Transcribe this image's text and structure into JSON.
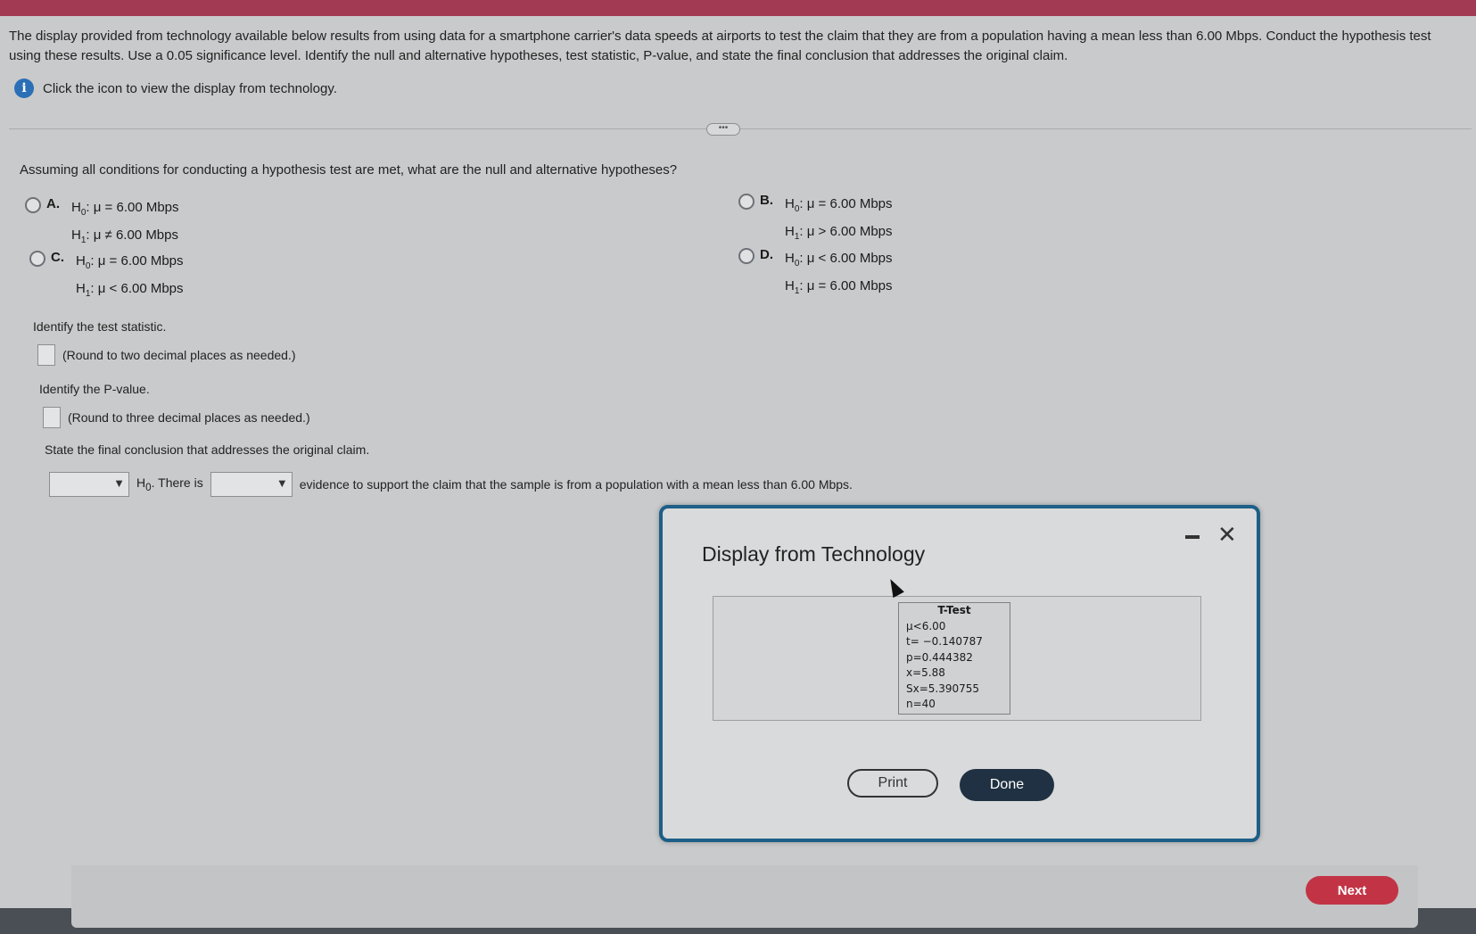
{
  "intro": {
    "text": "The display provided from technology available below results from using data for a smartphone carrier's data speeds at airports to test the claim that they are from a population having a mean less than 6.00 Mbps. Conduct the hypothesis test using these results. Use a 0.05 significance level. Identify the null and alternative hypotheses, test statistic, P-value, and state the final conclusion that addresses the original claim.",
    "info_link": "Click the icon to view the display from technology."
  },
  "collapse_handle": "•••",
  "question": "Assuming all conditions for conducting a hypothesis test are met, what are the null and alternative hypotheses?",
  "options": [
    {
      "letter": "A.",
      "h0_rel": ": μ = 6.00 Mbps",
      "h1_rel": ": μ ≠ 6.00 Mbps"
    },
    {
      "letter": "B.",
      "h0_rel": ": μ = 6.00 Mbps",
      "h1_rel": ": μ > 6.00 Mbps"
    },
    {
      "letter": "C.",
      "h0_rel": ": μ = 6.00 Mbps",
      "h1_rel": ": μ < 6.00 Mbps"
    },
    {
      "letter": "D.",
      "h0_rel": ": μ < 6.00 Mbps",
      "h1_rel": ": μ = 6.00 Mbps"
    }
  ],
  "hyp_symbols": {
    "h": "H",
    "sub0": "0",
    "sub1": "1"
  },
  "test_stat": {
    "label": "Identify the test statistic.",
    "hint": "(Round to two decimal places as needed.)"
  },
  "pvalue": {
    "label": "Identify the P-value.",
    "hint": "(Round to three decimal places as needed.)"
  },
  "conclusion": {
    "label": "State the final conclusion that addresses the original claim.",
    "select_arrow": "▼",
    "h0_text": "H",
    "h0_sub": "0",
    "mid_text": ". There is",
    "tail_text": "evidence to support the claim that the sample is from a population with a mean less than 6.00 Mbps."
  },
  "modal": {
    "title": "Display from Technology",
    "close_glyph": "✕",
    "calc": {
      "header": "T-Test",
      "lines": [
        "μ<6.00",
        "t= −0.140787",
        "p=0.444382",
        "x=5.88",
        "Sx=5.390755",
        "n=40"
      ]
    },
    "print_label": "Print",
    "done_label": "Done"
  },
  "next_label": "Next",
  "colors": {
    "accent_top": "#a33a54",
    "modal_border": "#1d5f88",
    "done_bg": "#1f3142",
    "next_bg": "#c23445",
    "info_icon": "#2b6fb6"
  },
  "icons": {
    "info": "info-icon",
    "close": "close-icon",
    "minimize": "minimize-icon",
    "cursor": "mouse-cursor-icon"
  }
}
